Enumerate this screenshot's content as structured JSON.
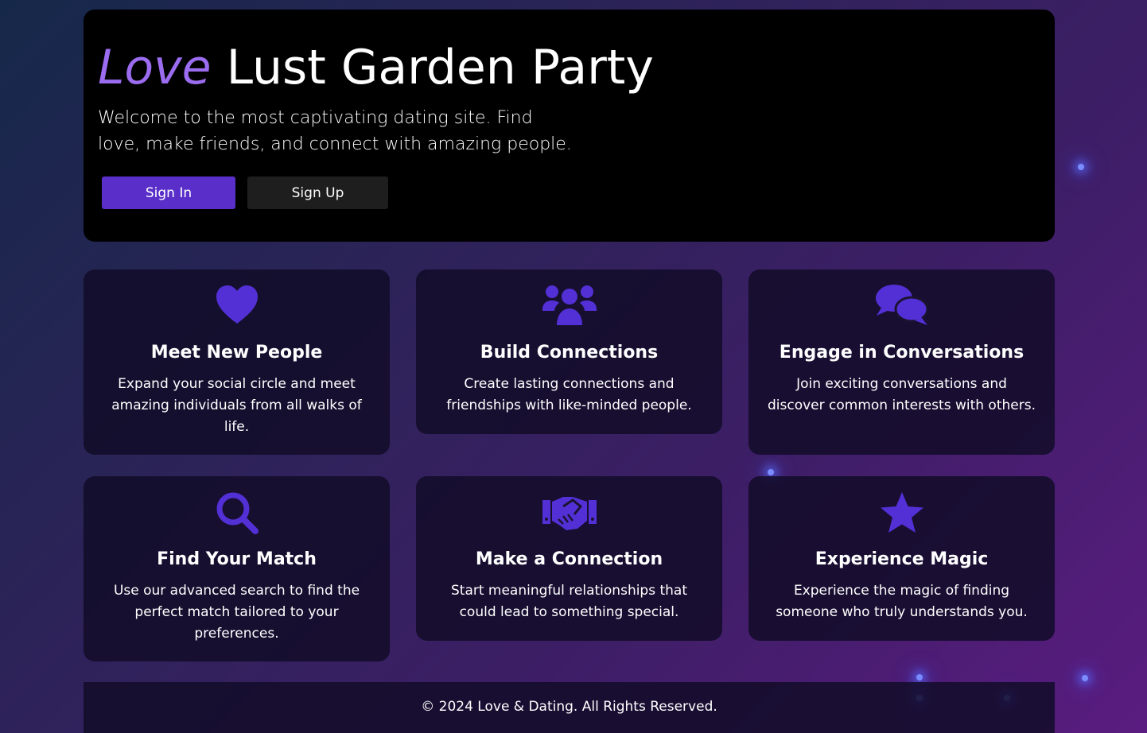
{
  "hero": {
    "title_accent": "Love",
    "title_rest": "Lust Garden Party",
    "description": "Welcome to the most captivating dating site. Find love, make friends, and connect with amazing people.",
    "sign_in_label": "Sign In",
    "sign_up_label": "Sign Up"
  },
  "features": [
    {
      "icon": "heart-icon",
      "title": "Meet New People",
      "text": "Expand your social circle and meet amazing individuals from all walks of life."
    },
    {
      "icon": "users-icon",
      "title": "Build Connections",
      "text": "Create lasting connections and friendships with like-minded people."
    },
    {
      "icon": "comments-icon",
      "title": "Engage in Conversations",
      "text": "Join exciting conversations and discover common interests with others."
    },
    {
      "icon": "search-icon",
      "title": "Find Your Match",
      "text": "Use our advanced search to find the perfect match tailored to your preferences."
    },
    {
      "icon": "handshake-icon",
      "title": "Make a Connection",
      "text": "Start meaningful relationships that could lead to something special."
    },
    {
      "icon": "star-icon",
      "title": "Experience Magic",
      "text": "Experience the magic of finding someone who truly understands you."
    }
  ],
  "footer": {
    "copyright": "© 2024 Love & Dating. All Rights Reserved."
  },
  "colors": {
    "accent": "#5a2fc9",
    "icon": "#5330d6",
    "title_accent": "#9b6cf0",
    "hero_bg": "#000000"
  }
}
